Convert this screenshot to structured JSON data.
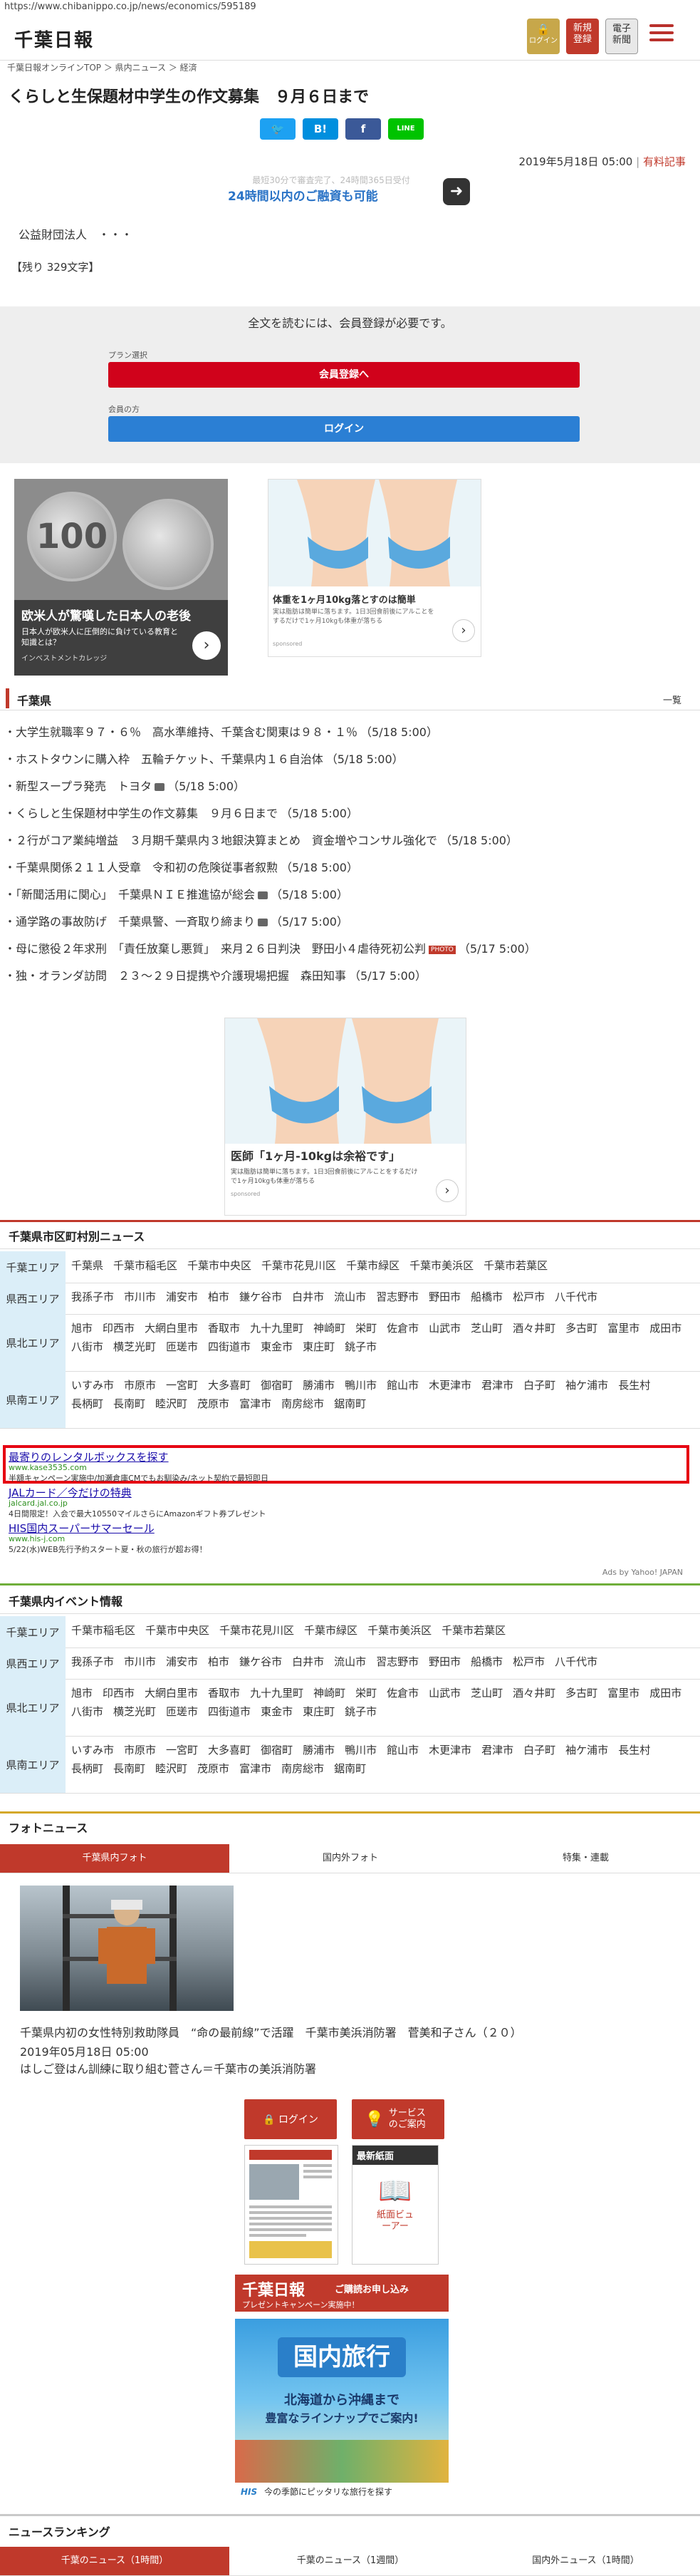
{
  "url": "https://www.chibanippo.co.jp/news/economics/595189",
  "header": {
    "logo": "千葉日報",
    "login": "ログイン",
    "register": "新規登録",
    "epaper": "電子新聞"
  },
  "breadcrumb": "千葉日報オンラインTOP ＞ 県内ニュース ＞ 経済",
  "article": {
    "title": "くらしと生保題材中学生の作文募集　９月６日まで",
    "date": "2019年5月18日 05:00",
    "sep": "|",
    "paid": "有料記事",
    "org": "公益財団法人　・・・",
    "remaining": "【残り 329文字】"
  },
  "share": {
    "twitter": "t",
    "hatena": "B!",
    "facebook": "f",
    "line": "LINE"
  },
  "ad_top": {
    "small": "最短30分で審査完了、24時間365日受付",
    "main": "24時間以内のご融資も可能",
    "arrow": "➜"
  },
  "member": {
    "message": "全文を読むには、会員登録が必要です。",
    "plan_label": "プラン選択",
    "register_button": "会員登録へ",
    "member_label": "会員の方",
    "login_button": "ログイン"
  },
  "promo": {
    "coin_label": "100",
    "left_title": "欧米人が驚嘆した日本人の老後",
    "left_desc": "日本人が欧米人に圧倒的に負けている教育と知識とは？",
    "left_source": "インベストメントカレッジ",
    "right_title": "体重を1ヶ月10kg落とすのは簡単",
    "right_desc": "実は脂肪は簡単に落ちます。1日3回食前後にアルことをするだけで1ヶ月10kgも体重が落ちる",
    "right_source": "sponsored",
    "arrow": "›"
  },
  "chiba_section": {
    "title": "千葉県",
    "more": "一覧"
  },
  "news": [
    {
      "text": "大学生就職率９７・６％　高水準維持、千葉含む関東は９８・１％",
      "time": "（5/18 5:00）",
      "cam": false,
      "badge": false
    },
    {
      "text": "ホストタウンに購入枠　五輪チケット、千葉県内１６自治体",
      "time": "（5/18 5:00）",
      "cam": false,
      "badge": false
    },
    {
      "text": "新型スープラ発売　トヨタ",
      "time": "（5/18 5:00）",
      "cam": true,
      "badge": false
    },
    {
      "text": "くらしと生保題材中学生の作文募集　９月６日まで",
      "time": "（5/18 5:00）",
      "cam": false,
      "badge": false
    },
    {
      "text": "２行がコア業純増益　３月期千葉県内３地銀決算まとめ　資金増やコンサル強化で",
      "time": "（5/18 5:00）",
      "cam": false,
      "badge": false
    },
    {
      "text": "千葉県関係２１１人受章　令和初の危険従事者叙勲",
      "time": "（5/18 5:00）",
      "cam": false,
      "badge": false
    },
    {
      "text": "「新聞活用に関心」　千葉県ＮＩＥ推進協が総会",
      "time": "（5/18 5:00）",
      "cam": true,
      "badge": false
    },
    {
      "text": "通学路の事故防げ　千葉県警、一斉取り締まり",
      "time": "（5/17 5:00）",
      "cam": true,
      "badge": false
    },
    {
      "text": "母に懲役２年求刑　「責任放棄し悪質」　来月２６日判決　野田小４虐待死初公判",
      "time": "（5/17 5:00）",
      "cam": false,
      "badge": true
    },
    {
      "text": "独・オランダ訪問　２３～２９日提携や介護現場把握　森田知事",
      "time": "（5/17 5:00）",
      "cam": false,
      "badge": false
    }
  ],
  "badge_label": "PHOTO",
  "promo_bottom": {
    "title": "医師「1ヶ月-10kgは余裕です」",
    "desc": "実は脂肪は簡単に落ちます。1日3回食前後にアルことをするだけで1ヶ月10kgも体重が落ちる",
    "source": "sponsored",
    "arrow": "›"
  },
  "areas_news": {
    "title": "千葉県市区町村別ニュース",
    "rows": [
      {
        "label": "千葉エリア",
        "cities": [
          "千葉県",
          "千葉市稲毛区",
          "千葉市中央区",
          "千葉市花見川区",
          "千葉市緑区",
          "千葉市美浜区",
          "千葉市若葉区"
        ]
      },
      {
        "label": "県西エリア",
        "cities": [
          "我孫子市",
          "市川市",
          "浦安市",
          "柏市",
          "鎌ケ谷市",
          "白井市",
          "流山市",
          "習志野市",
          "野田市",
          "船橋市",
          "松戸市",
          "八千代市"
        ]
      },
      {
        "label": "県北エリア",
        "cities": [
          "旭市",
          "印西市",
          "大網白里市",
          "香取市",
          "九十九里町",
          "神崎町",
          "栄町",
          "佐倉市",
          "山武市",
          "芝山町",
          "酒々井町",
          "多古町",
          "富里市",
          "成田市",
          "八街市",
          "横芝光町",
          "匝瑳市",
          "四街道市",
          "東金市",
          "東庄町",
          "銚子市"
        ]
      },
      {
        "label": "県南エリア",
        "cities": [
          "いすみ市",
          "市原市",
          "一宮町",
          "大多喜町",
          "御宿町",
          "勝浦市",
          "鴨川市",
          "館山市",
          "木更津市",
          "君津市",
          "白子町",
          "袖ケ浦市",
          "長生村",
          "長柄町",
          "長南町",
          "睦沢町",
          "茂原市",
          "富津市",
          "南房総市",
          "鋸南町"
        ]
      }
    ]
  },
  "yahoo_ads": [
    {
      "title": "最寄りのレンタルボックスを探す",
      "url": "www.kase3535.com",
      "desc": "半額キャンペーン実施中/加瀬倉庫CMでもお馴染み/ネット契約で最短即日"
    },
    {
      "title": "JALカード／今だけの特典",
      "url": "jalcard.jal.co.jp",
      "desc": "4日間限定！入会で最大10550マイルさらにAmazonギフト券プレゼント"
    },
    {
      "title": "HIS国内スーパーサマーセール",
      "url": "www.his-j.com",
      "desc": "5/22(水)WEB先行予約スタート夏・秋の旅行が超お得！"
    }
  ],
  "ads_by": "Ads by Yahoo! JAPAN",
  "areas_events": {
    "title": "千葉県内イベント情報",
    "rows": [
      {
        "label": "千葉エリア",
        "cities": [
          "千葉市稲毛区",
          "千葉市中央区",
          "千葉市花見川区",
          "千葉市緑区",
          "千葉市美浜区",
          "千葉市若葉区"
        ]
      },
      {
        "label": "県西エリア",
        "cities": [
          "我孫子市",
          "市川市",
          "浦安市",
          "柏市",
          "鎌ケ谷市",
          "白井市",
          "流山市",
          "習志野市",
          "野田市",
          "船橋市",
          "松戸市",
          "八千代市"
        ]
      },
      {
        "label": "県北エリア",
        "cities": [
          "旭市",
          "印西市",
          "大網白里市",
          "香取市",
          "九十九里町",
          "神崎町",
          "栄町",
          "佐倉市",
          "山武市",
          "芝山町",
          "酒々井町",
          "多古町",
          "富里市",
          "成田市",
          "八街市",
          "横芝光町",
          "匝瑳市",
          "四街道市",
          "東金市",
          "東庄町",
          "銚子市"
        ]
      },
      {
        "label": "県南エリア",
        "cities": [
          "いすみ市",
          "市原市",
          "一宮町",
          "大多喜町",
          "御宿町",
          "勝浦市",
          "鴨川市",
          "館山市",
          "木更津市",
          "君津市",
          "白子町",
          "袖ケ浦市",
          "長生村",
          "長柄町",
          "長南町",
          "睦沢町",
          "茂原市",
          "富津市",
          "南房総市",
          "鋸南町"
        ]
      }
    ]
  },
  "photo_news": {
    "title": "フォトニュース",
    "tabs": [
      "千葉県内フォト",
      "国内外フォト",
      "特集・連載"
    ],
    "caption": "千葉県内初の女性特別救助隊員　“命の最前線”で活躍　千葉市美浜消防署　菅美和子さん（２０）",
    "date": "2019年05月18日 05:00",
    "sub": "はしご登はん訓練に取り組む菅さん＝千葉市の美浜消防署"
  },
  "service": {
    "login": "ログイン",
    "service_info": "サービスのご案内",
    "latest": "最新紙面",
    "viewer": "紙面ビューアー"
  },
  "banner": {
    "logo": "千葉日報",
    "subscribe": "ご購読お申し込み",
    "campaign": "プレゼントキャンペーン実施中！",
    "travel": "国内旅行",
    "copy1": "北海道から沖縄まで",
    "copy2": "豊富なラインナップでご案内!",
    "his": "HIS",
    "foot": "今の季節にピッタリな旅行を探す"
  },
  "ranking": {
    "title": "ニュースランキング",
    "tabs": [
      "千葉のニュース（1時間）",
      "千葉のニュース（1週間）",
      "国内外ニュース（1時間）"
    ]
  }
}
